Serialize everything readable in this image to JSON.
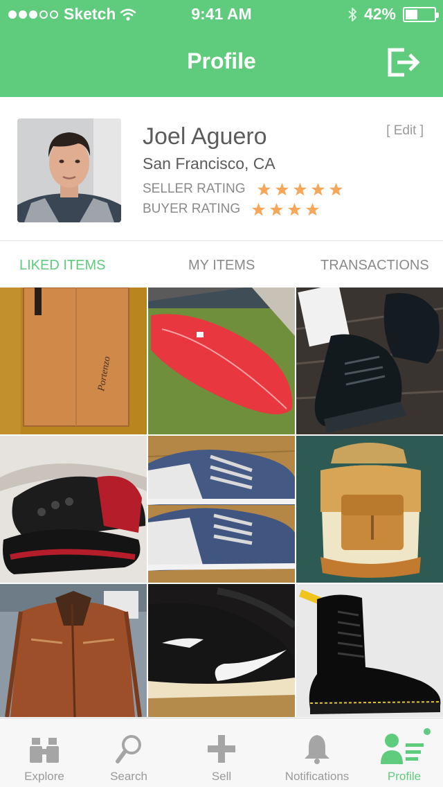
{
  "status_bar": {
    "carrier": "Sketch",
    "time": "9:41 AM",
    "battery": "42%",
    "battery_level": 0.42,
    "signal_bars_filled": 3,
    "signal_bars_total": 5
  },
  "header": {
    "title": "Profile",
    "logout_icon": "logout-icon"
  },
  "profile": {
    "name": "Joel Aguero",
    "location": "San Francisco, CA",
    "edit_label": "[ Edit ]",
    "seller_rating_label": "SELLER RATING",
    "seller_rating_stars": 5,
    "buyer_rating_label": "BUYER RATING",
    "buyer_rating_stars": 4
  },
  "tabs": [
    {
      "label": "LIKED ITEMS",
      "active": true
    },
    {
      "label": "MY ITEMS",
      "active": false
    },
    {
      "label": "TRANSACTIONS",
      "active": false
    }
  ],
  "grid_items": [
    {
      "name": "cork-board-photo"
    },
    {
      "name": "red-surfboard-photo"
    },
    {
      "name": "black-platform-sneakers-photo"
    },
    {
      "name": "red-black-basketball-shoes-photo"
    },
    {
      "name": "blue-canvas-sneakers-photo"
    },
    {
      "name": "canvas-leather-backpack-photo"
    },
    {
      "name": "brown-leather-jacket-photo"
    },
    {
      "name": "black-nike-sneakers-photo"
    },
    {
      "name": "black-leather-boot-photo"
    }
  ],
  "tab_bar": [
    {
      "label": "Explore",
      "icon": "binoculars-icon",
      "active": false
    },
    {
      "label": "Search",
      "icon": "search-icon",
      "active": false
    },
    {
      "label": "Sell",
      "icon": "plus-icon",
      "active": false
    },
    {
      "label": "Notifications",
      "icon": "bell-icon",
      "active": false
    },
    {
      "label": "Profile",
      "icon": "profile-icon",
      "active": true
    }
  ],
  "colors": {
    "brand_green": "#5fcb7c",
    "star_orange": "#f7a75a",
    "text_dark": "#5b5b5b",
    "text_gray": "#8a8a8a"
  }
}
